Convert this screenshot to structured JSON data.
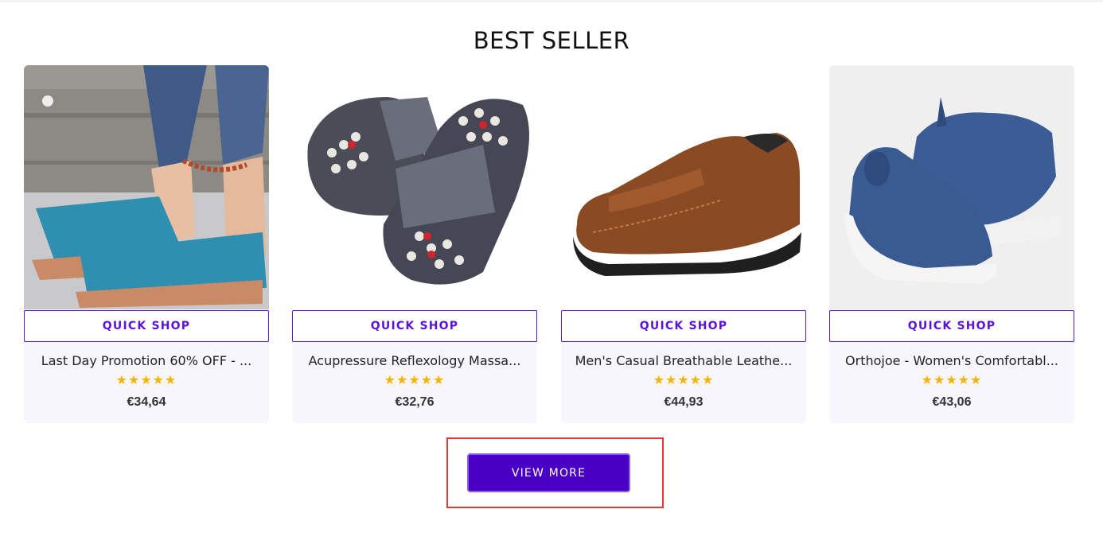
{
  "section": {
    "title": "BEST SELLER"
  },
  "products": [
    {
      "name": "Last Day Promotion 60% OFF - ...",
      "price": "€34,64",
      "quick_shop": "QUICK SHOP",
      "stars": "★★★★★",
      "rating": 5
    },
    {
      "name": "Acupressure Reflexology Massa...",
      "price": "€32,76",
      "quick_shop": "QUICK SHOP",
      "stars": "★★★★★",
      "rating": 5
    },
    {
      "name": "Men's Casual Breathable Leathe...",
      "price": "€44,93",
      "quick_shop": "QUICK SHOP",
      "stars": "★★★★★",
      "rating": 5
    },
    {
      "name": "Orthojoe - Women's Comfortabl...",
      "price": "€43,06",
      "quick_shop": "QUICK SHOP",
      "stars": "★★★★★",
      "rating": 5
    }
  ],
  "view_more": {
    "label": "VIEW MORE"
  },
  "colors": {
    "accent": "#5b13d6",
    "button": "#4a00c4",
    "star": "#f4b400",
    "highlight": "#e53935",
    "card_bg": "#f7f6fc"
  }
}
